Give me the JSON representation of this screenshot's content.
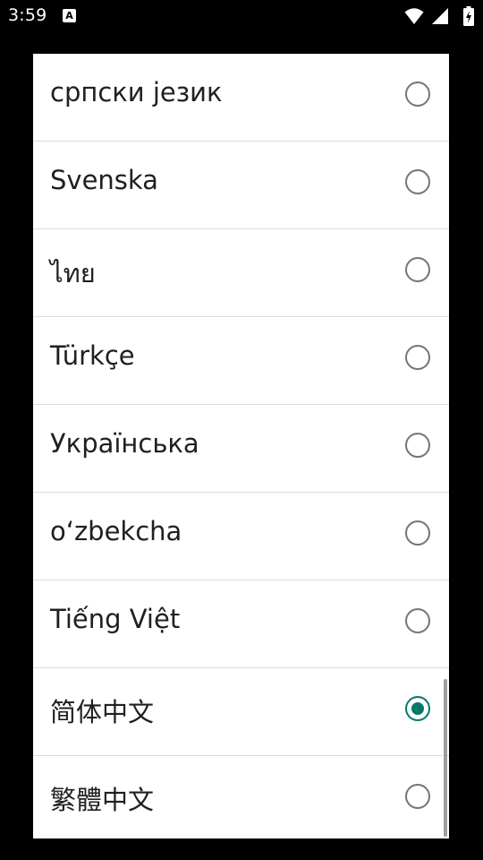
{
  "status_bar": {
    "time": "3:59",
    "notification_icon_label": "A",
    "icons": [
      "wifi-icon",
      "cellular-signal-icon",
      "battery-charging-icon"
    ]
  },
  "colors": {
    "accent": "#00796b",
    "radio_unchecked": "#757575",
    "divider": "#dcdcdc",
    "text": "#202020",
    "background": "#000000",
    "dialog_background": "#ffffff"
  },
  "language_dialog": {
    "options": [
      {
        "label": "српски језик",
        "selected": false
      },
      {
        "label": "Svenska",
        "selected": false
      },
      {
        "label": "ไทย",
        "selected": false
      },
      {
        "label": "Türkçe",
        "selected": false
      },
      {
        "label": "Українська",
        "selected": false
      },
      {
        "label": "oʻzbekcha",
        "selected": false
      },
      {
        "label": "Tiếng Việt",
        "selected": false
      },
      {
        "label": "简体中文",
        "selected": true
      },
      {
        "label": "繁體中文",
        "selected": false
      }
    ]
  }
}
